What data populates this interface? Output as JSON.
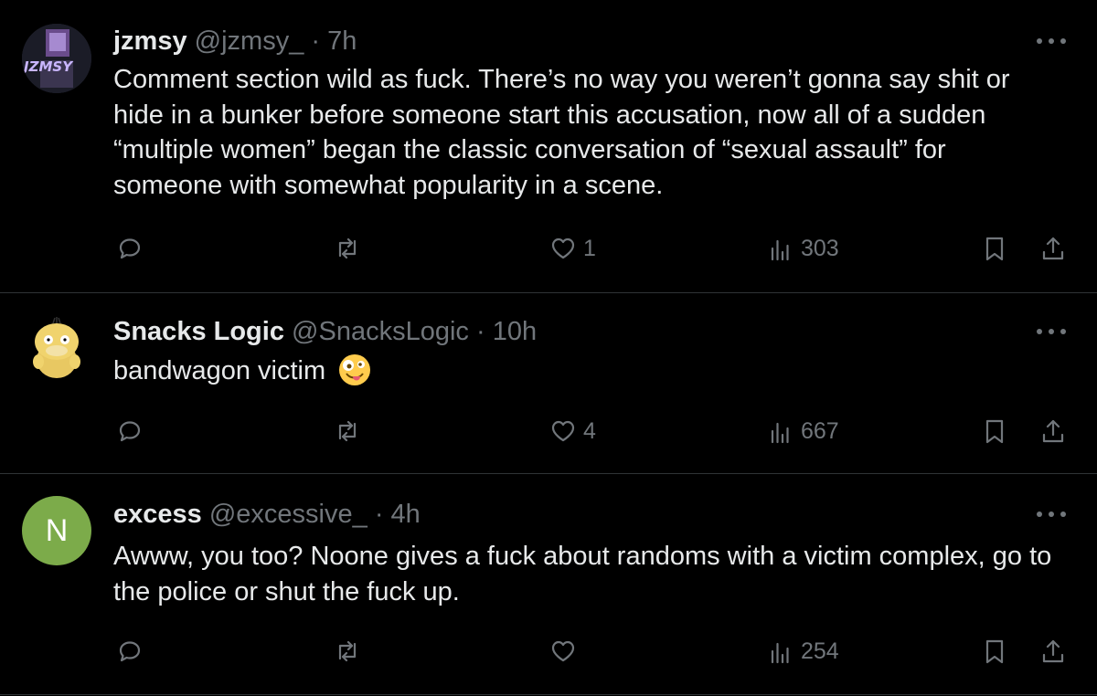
{
  "tweets": [
    {
      "name": "jzmsy",
      "handle": "@jzmsy_",
      "separator": "·",
      "time": "7h",
      "avatar_text": "JZMSY",
      "text": "Comment section wild as fuck. There’s no way you weren’t gonna say shit or hide in a  bunker before someone start this accusation, now all of a sudden “multiple women” began the classic conversation of “sexual assault” for someone with somewhat popularity in a scene.",
      "replies": "",
      "retweets": "",
      "likes": "1",
      "views": "303"
    },
    {
      "name": "Snacks Logic",
      "handle": "@SnacksLogic",
      "separator": "·",
      "time": "10h",
      "text": "bandwagon victim",
      "replies": "",
      "retweets": "",
      "likes": "4",
      "views": "667"
    },
    {
      "name": "excess",
      "handle": "@excessive_",
      "separator": "·",
      "time": "4h",
      "avatar_letter": "N",
      "text": "Awww, you too? Noone gives a fuck about randoms with a victim complex, go to the police or shut the fuck up.",
      "replies": "",
      "retweets": "",
      "likes": "",
      "views": "254"
    }
  ],
  "colors": {
    "background": "#000000",
    "text": "#e7e9ea",
    "muted": "#71767b",
    "divider": "#2f3336",
    "avatar_green": "#7cab4a"
  },
  "icons": [
    "reply-icon",
    "retweet-icon",
    "like-icon",
    "views-icon",
    "bookmark-icon",
    "share-icon",
    "more-icon"
  ]
}
